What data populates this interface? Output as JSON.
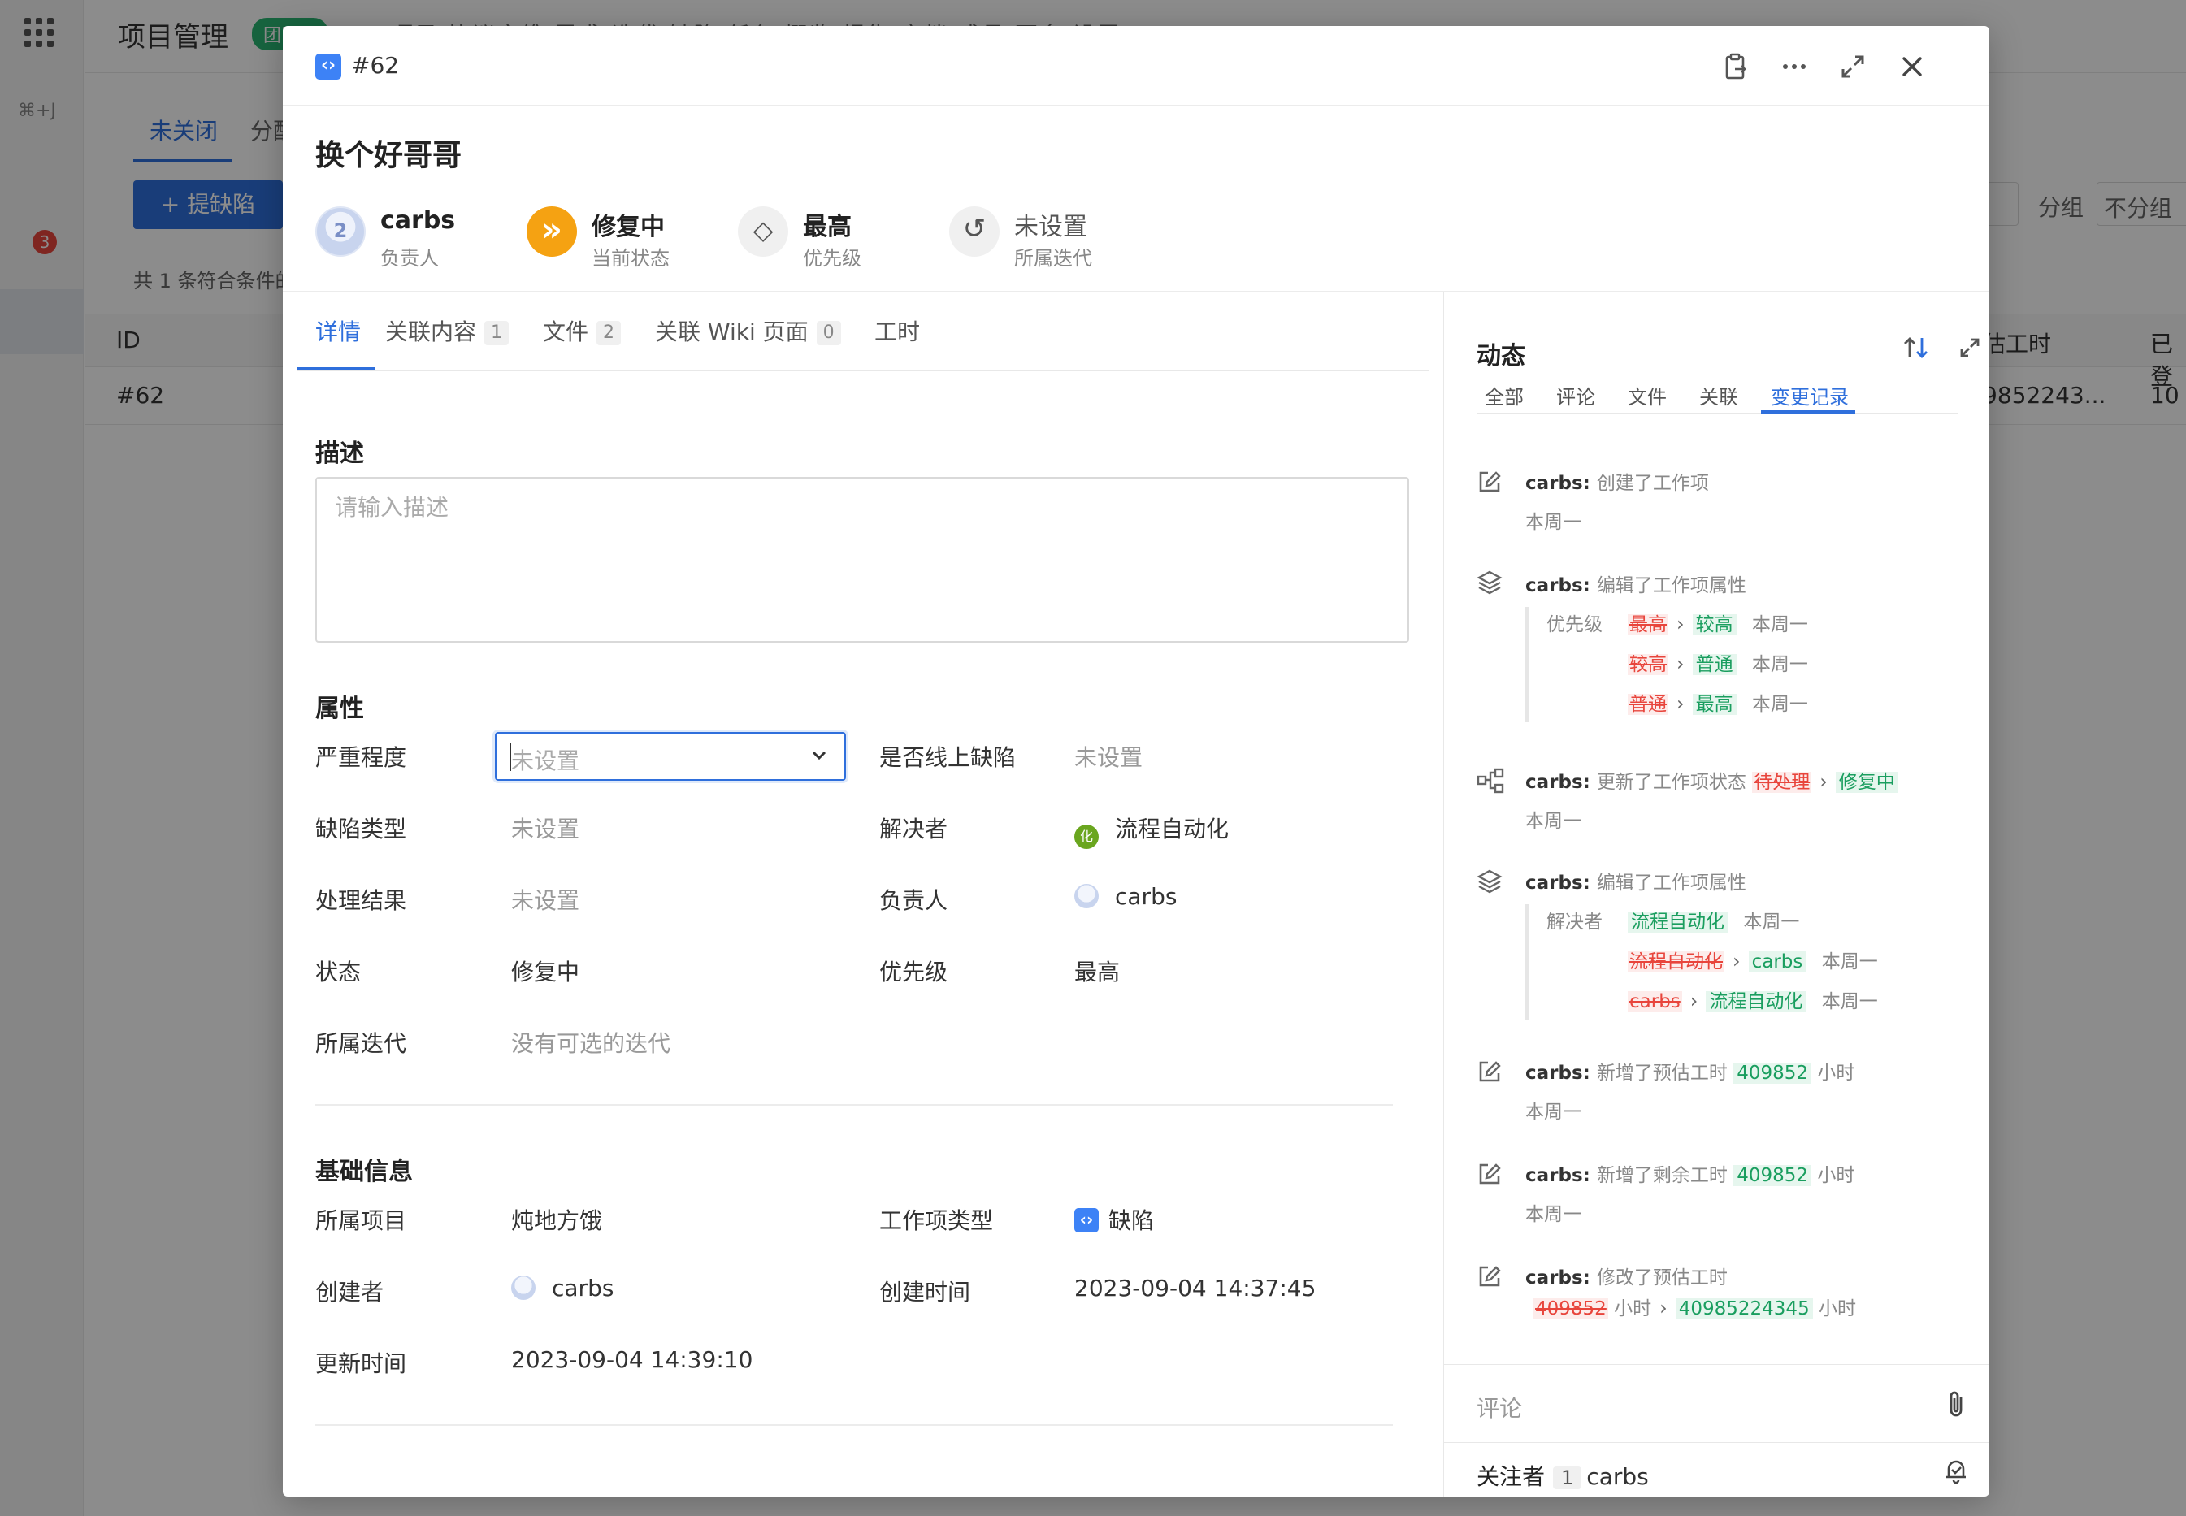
{
  "background": {
    "app_title": "项目管理",
    "app_tag": "团队版",
    "nav_text": "项目   协议方维   需求   迭代   缺陷   任务   概览   报告   文档   成员   更多   设置",
    "shortcut": "⌘+J",
    "notification_count": "3",
    "tab_open": "未关闭",
    "tab_assigned": "分配",
    "new_bug_button": "+ 提缺陷",
    "result_count": "共 1 条符合条件的",
    "group_label": "分组",
    "group_value": "不分组",
    "col_id": "ID",
    "col_estimate": "估工时",
    "col_done": "已登",
    "row_id": "#62",
    "row_estimate": "9852243...",
    "row_done": "10"
  },
  "modal": {
    "id": "#62",
    "title": "换个好哥哥",
    "summary": {
      "assignee": {
        "name": "carbs",
        "label": "负责人"
      },
      "status": {
        "name": "修复中",
        "label": "当前状态"
      },
      "priority": {
        "name": "最高",
        "label": "优先级"
      },
      "iteration": {
        "name": "未设置",
        "label": "所属迭代"
      }
    },
    "tabs": [
      {
        "label": "详情"
      },
      {
        "label": "关联内容",
        "count": "1"
      },
      {
        "label": "文件",
        "count": "2"
      },
      {
        "label": "关联 Wiki 页面",
        "count": "0"
      },
      {
        "label": "工时"
      }
    ],
    "description": {
      "title": "描述",
      "placeholder": "请输入描述"
    },
    "attributes": {
      "title": "属性",
      "severity": {
        "label": "严重程度",
        "value": "未设置"
      },
      "online_bug": {
        "label": "是否线上缺陷",
        "value": "未设置"
      },
      "bug_type": {
        "label": "缺陷类型",
        "value": "未设置"
      },
      "resolver": {
        "label": "解决者",
        "value": "流程自动化",
        "avatar": "化"
      },
      "result": {
        "label": "处理结果",
        "value": "未设置"
      },
      "owner": {
        "label": "负责人",
        "value": "carbs"
      },
      "state": {
        "label": "状态",
        "value": "修复中"
      },
      "priority": {
        "label": "优先级",
        "value": "最高"
      },
      "iteration": {
        "label": "所属迭代",
        "value": "没有可选的迭代"
      }
    },
    "basic": {
      "title": "基础信息",
      "project": {
        "label": "所属项目",
        "value": "炖地方饿"
      },
      "item_type": {
        "label": "工作项类型",
        "value": "缺陷"
      },
      "creator": {
        "label": "创建者",
        "value": "carbs"
      },
      "created_at": {
        "label": "创建时间",
        "value": "2023-09-04 14:37:45"
      },
      "updated_at": {
        "label": "更新时间",
        "value": "2023-09-04 14:39:10"
      }
    },
    "activity": {
      "title": "动态",
      "tabs": [
        "全部",
        "评论",
        "文件",
        "关联",
        "变更记录"
      ],
      "user": "carbs",
      "time": "本周一",
      "e1_action": "创建了工作项",
      "e2_action": "编辑了工作项属性",
      "e2_field": "优先级",
      "e2_r1_old": "最高",
      "e2_r1_new": "较高",
      "e2_r2_old": "较高",
      "e2_r2_new": "普通",
      "e2_r3_old": "普通",
      "e2_r3_new": "最高",
      "e3_action": "更新了工作项状态",
      "e3_old": "待处理",
      "e3_new": "修复中",
      "e4_action": "编辑了工作项属性",
      "e4_field": "解决者",
      "e4_r1_new": "流程自动化",
      "e4_r2_old": "流程自动化",
      "e4_r2_new": "carbs",
      "e4_r3_old": "carbs",
      "e4_r3_new": "流程自动化",
      "e5_action": "新增了预估工时",
      "e5_value": "409852",
      "unit": "小时",
      "e6_action": "新增了剩余工时",
      "e6_value": "409852",
      "e7_action": "修改了预估工时",
      "e7_old": "409852",
      "e7_new": "40985224345"
    },
    "comment_placeholder": "评论",
    "followers": {
      "label": "关注者",
      "count": "1",
      "user": "carbs"
    }
  }
}
